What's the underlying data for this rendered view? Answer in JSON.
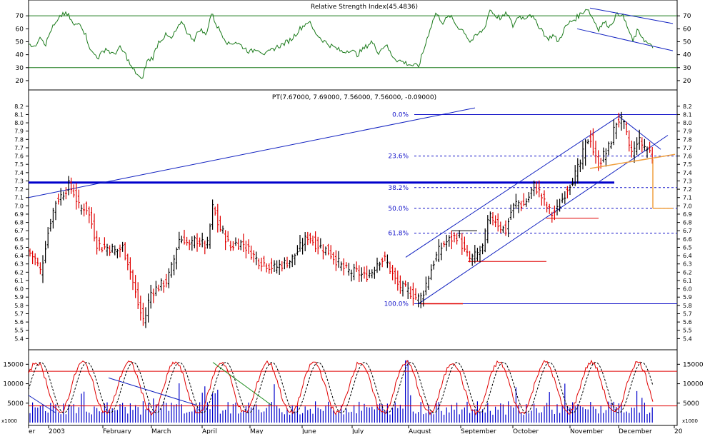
{
  "colors": {
    "frame": "#000000",
    "rsi_line": "#1a7a1a",
    "rsi_levels": "#1a7a1a",
    "channel": "#1020c0",
    "resistance": "#0000cc",
    "fib": "#1010c8",
    "bar_up": "#000000",
    "bar_down": "#e00000",
    "target": "#f0a040",
    "stoch_k": "#e00000",
    "stoch_d": "#000000",
    "volume": "#0000cc",
    "stoch_levels": "#e00000"
  },
  "rsi": {
    "title": "Relative Strength Index(45.4836)",
    "ticks_left": [
      "20",
      "30",
      "40",
      "50",
      "60",
      "70"
    ],
    "ticks_right": [
      "20",
      "30",
      "40",
      "50",
      "60",
      "70"
    ],
    "levels": [
      30,
      70
    ],
    "ylim": [
      15,
      80
    ]
  },
  "price": {
    "title": "PT(7.67000, 7.69000, 7.56000, 7.56000, -0.09000)",
    "ticks": [
      "5.4",
      "5.5",
      "5.6",
      "5.7",
      "5.8",
      "5.9",
      "6.0",
      "6.1",
      "6.2",
      "6.3",
      "6.4",
      "6.5",
      "6.6",
      "6.7",
      "6.8",
      "6.9",
      "7.0",
      "7.1",
      "7.2",
      "7.3",
      "7.4",
      "7.5",
      "7.6",
      "7.7",
      "7.8",
      "7.9",
      "8.0",
      "8.1",
      "8.2"
    ],
    "ylim": [
      5.3,
      8.25
    ],
    "resistance": 7.28,
    "fib_labels": [
      "0.0%",
      "23.6%",
      "38.2%",
      "50.0%",
      "61.8%",
      "100.0%"
    ],
    "fib_levels": [
      8.1,
      7.6,
      7.22,
      6.97,
      6.67,
      5.82
    ]
  },
  "stoch": {
    "ticks": [
      "5000",
      "10000",
      "15000"
    ],
    "multiplier": "x1000",
    "levels": [
      13200,
      4300
    ],
    "ylim": [
      0,
      18000
    ]
  },
  "x_axis": {
    "labels": [
      "er",
      "2003",
      "February",
      "March",
      "April",
      "May",
      "June",
      "July",
      "August",
      "September",
      "October",
      "November",
      "December",
      "20"
    ]
  },
  "chart_data": {
    "type": "line",
    "title": "PT(7.67000, 7.69000, 7.56000, 7.56000, -0.09000)",
    "xlabel": "",
    "ylabel": "",
    "ylim": [
      5.3,
      8.25
    ],
    "grid": false,
    "x": [
      "Jan-03",
      "Jan-03",
      "Jan-03",
      "Feb-03",
      "Feb-03",
      "Mar-03",
      "Mar-03",
      "Apr-03",
      "Apr-03",
      "May-03",
      "May-03",
      "Jun-03",
      "Jun-03",
      "Jul-03",
      "Jul-03",
      "Aug-03",
      "Aug-03",
      "Sep-03",
      "Sep-03",
      "Oct-03",
      "Oct-03",
      "Nov-03",
      "Nov-03",
      "Dec-03",
      "Dec-03"
    ],
    "series": [
      {
        "name": "PT",
        "values": [
          6.35,
          6.6,
          7.25,
          6.9,
          6.5,
          5.6,
          6.1,
          7.0,
          6.4,
          6.6,
          6.3,
          6.5,
          6.6,
          6.2,
          6.45,
          5.85,
          6.5,
          6.4,
          6.85,
          7.2,
          6.95,
          7.6,
          8.1,
          7.6,
          7.56
        ]
      },
      {
        "name": "Relative Strength Index",
        "values": [
          45,
          65,
          72,
          45,
          40,
          22,
          55,
          70,
          45,
          58,
          40,
          60,
          48,
          50,
          35,
          30,
          70,
          55,
          62,
          70,
          60,
          72,
          76,
          58,
          45.48
        ]
      },
      {
        "name": "Volume (x1000)",
        "values": [
          2500,
          3200,
          6000,
          3000,
          2800,
          6500,
          3500,
          9000,
          5000,
          4000,
          3500,
          5000,
          4000,
          3000,
          3500,
          2800,
          5000,
          4000,
          4500,
          4500,
          3500,
          5000,
          6000,
          5500,
          4500
        ]
      }
    ]
  }
}
